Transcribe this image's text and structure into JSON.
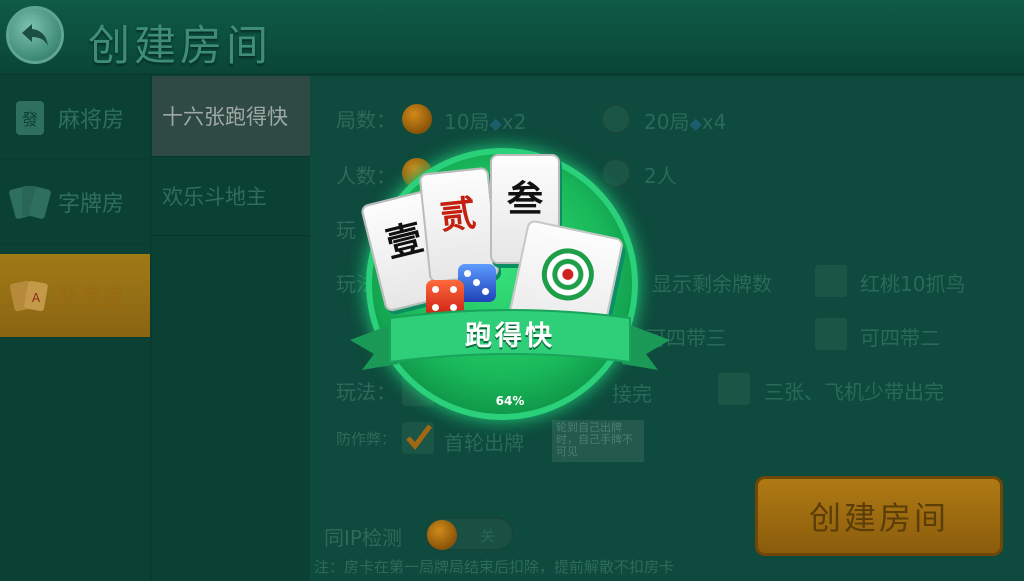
{
  "header": {
    "title": "创建房间"
  },
  "leftnav": {
    "items": [
      {
        "label": "麻将房",
        "icon": "mahjong-tile-icon"
      },
      {
        "label": "字牌房",
        "icon": "zipai-cards-icon"
      },
      {
        "label": "扑克房",
        "icon": "poker-cards-icon"
      }
    ]
  },
  "subnav": {
    "items": [
      "十六张跑得快",
      "欢乐斗地主"
    ]
  },
  "form": {
    "rounds_label": "局数：",
    "rounds_opt1": "10局",
    "rounds_opt1_cost": "x2",
    "rounds_opt2": "20局",
    "rounds_opt2_cost": "x4",
    "players_label": "人数：",
    "players_opt2": "2人",
    "play_label_short": "玩",
    "play2_label_short": "玩法",
    "opt_show_remaining": "显示剩余牌数",
    "opt_heart10": "红桃10抓鸟",
    "opt_four_three": "可四带三",
    "opt_four_two": "可四带二",
    "play3_label": "玩法：",
    "opt_connect_suffix": "接完",
    "opt_three_plane": "三张、飞机少带出完",
    "anticheat_label": "防作弊：",
    "opt_first_round": "首轮出牌",
    "tooltip": "轮到自己出牌时，自己手牌不可见",
    "same_ip_label": "同IP检测",
    "toggle_text": "关",
    "note": "注：房卡在第一局牌局结束后扣除，提前解散不扣房卡"
  },
  "create_button": "创建房间",
  "loading_overlay": {
    "tiles": [
      "壹",
      "贰",
      "叁"
    ],
    "ribbon_text": "跑得快",
    "progress_text": "64%",
    "progress": 0.64
  },
  "colors": {
    "accent": "#1fc066",
    "gold": "#a07a17",
    "bg": "#0e4a3d"
  }
}
